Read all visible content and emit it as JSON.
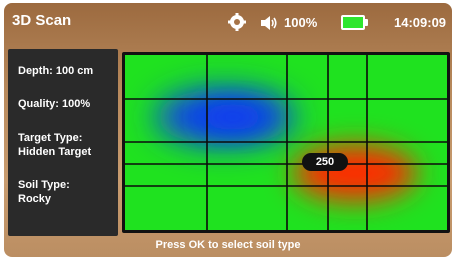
{
  "header": {
    "title": "3D Scan",
    "battery_percent": "100%",
    "time": "14:09:09"
  },
  "icons": {
    "settings": "gear-icon",
    "sound": "speaker-icon",
    "battery": "battery-icon"
  },
  "info": {
    "depth": "Depth: 100 cm",
    "quality": "Quality: 100%",
    "target_type_label": "Target Type:",
    "target_type_value": "Hidden Target",
    "soil_type_label": "Soil Type:",
    "soil_type_value": "Rocky"
  },
  "scan": {
    "value_label": "250",
    "colors": {
      "background": "#1fe21f",
      "low": "#0a3cf0",
      "high": "#ff2a05",
      "grid": "#0b0b0b"
    }
  },
  "footer": {
    "hint": "Press OK to select soil type"
  }
}
